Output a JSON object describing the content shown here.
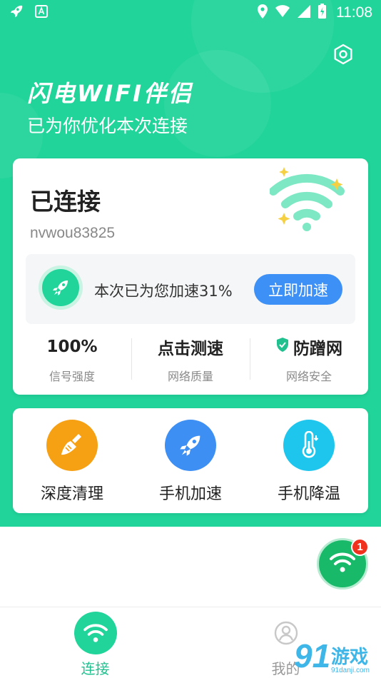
{
  "status_bar": {
    "time": "11:08"
  },
  "header": {
    "app_title": "闪电WIFI伴侣",
    "subtitle": "已为你优化本次连接"
  },
  "connection": {
    "status": "已连接",
    "ssid": "nvwou83825",
    "boost_text": "本次已为您加速31%",
    "boost_button": "立即加速"
  },
  "stats": [
    {
      "value": "100%",
      "label": "信号强度"
    },
    {
      "value": "点击测速",
      "label": "网络质量"
    },
    {
      "value": "防蹭网",
      "label": "网络安全"
    }
  ],
  "tools": [
    {
      "label": "深度清理",
      "icon": "broom-icon",
      "color": "#f6a014"
    },
    {
      "label": "手机加速",
      "icon": "rocket-icon",
      "color": "#3d8ff3"
    },
    {
      "label": "手机降温",
      "icon": "thermometer-icon",
      "color": "#1ec6ee"
    }
  ],
  "fab": {
    "badge": "1",
    "icon": "wifi-icon"
  },
  "bottom_nav": [
    {
      "label": "连接",
      "active": true
    },
    {
      "label": "我的",
      "active": false
    }
  ],
  "watermark": {
    "num": "91",
    "text": "游戏",
    "url": "91danji.com"
  },
  "colors": {
    "primary": "#21d49a",
    "button_blue": "#3d90f5",
    "badge_red": "#f0311e"
  }
}
